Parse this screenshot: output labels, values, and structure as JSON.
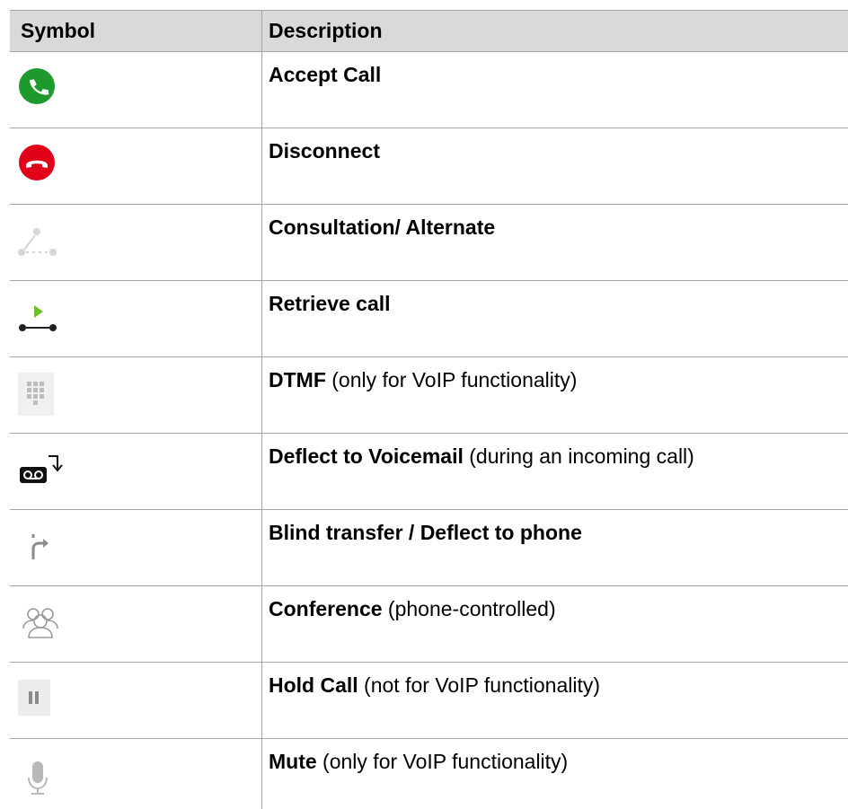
{
  "header": {
    "symbol": "Symbol",
    "description": "Description"
  },
  "rows": [
    {
      "icon": "accept-call-icon",
      "title": "Accept Call",
      "note": ""
    },
    {
      "icon": "disconnect-icon",
      "title": "Disconnect",
      "note": ""
    },
    {
      "icon": "consultation-icon",
      "title": "Consultation/ Alternate",
      "note": ""
    },
    {
      "icon": "retrieve-call-icon",
      "title": "Retrieve call",
      "note": ""
    },
    {
      "icon": "dialpad-icon",
      "title": "DTMF",
      "note": " (only for VoIP functionality)"
    },
    {
      "icon": "voicemail-deflect-icon",
      "title": "Deflect to Voicemail",
      "note": " (during an incoming call)"
    },
    {
      "icon": "blind-transfer-icon",
      "title": "Blind transfer / Deflect to phone",
      "note": ""
    },
    {
      "icon": "conference-icon",
      "title": "Conference",
      "note": " (phone-controlled)"
    },
    {
      "icon": "hold-icon",
      "title": "Hold Call",
      "note": " (not for VoIP functionality)"
    },
    {
      "icon": "microphone-icon",
      "title": "Mute",
      "note": " (only for VoIP functionality)"
    }
  ],
  "colors": {
    "header_bg": "#d9d9d9",
    "accept_green": "#1e9a2c",
    "disconnect_red": "#e1001a",
    "play_green": "#6cbf2a"
  }
}
